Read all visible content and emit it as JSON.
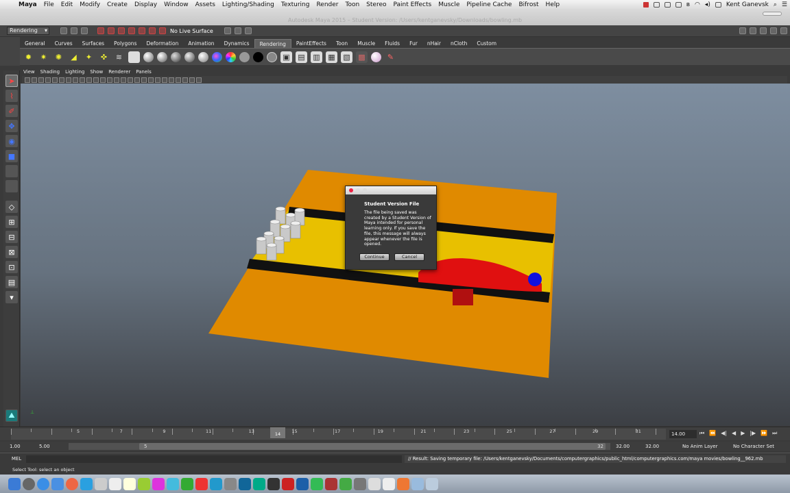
{
  "menubar": {
    "items": [
      "Maya",
      "File",
      "Edit",
      "Modify",
      "Create",
      "Display",
      "Window",
      "Assets",
      "Lighting/Shading",
      "Texturing",
      "Render",
      "Toon",
      "Stereo",
      "Paint Effects",
      "Muscle",
      "Pipeline Cache",
      "Bifrost",
      "Help"
    ],
    "user": "Kent Ganevsk"
  },
  "window": {
    "title": "Autodesk Maya 2015 – Student Version: /Users/kentganevsky/Downloads/bowling.mb"
  },
  "statusline": {
    "menuset": "Rendering",
    "live_surface": "No Live Surface"
  },
  "shelf": {
    "tabs": [
      "General",
      "Curves",
      "Surfaces",
      "Polygons",
      "Deformation",
      "Animation",
      "Dynamics",
      "Rendering",
      "PaintEffects",
      "Toon",
      "Muscle",
      "Fluids",
      "Fur",
      "nHair",
      "nCloth",
      "Custom"
    ],
    "active_tab": "Rendering"
  },
  "panel": {
    "menus": [
      "View",
      "Shading",
      "Lighting",
      "Show",
      "Renderer",
      "Panels"
    ]
  },
  "dialog": {
    "title": "Student Version File",
    "message": "The file being saved was created by a Student Version of Maya intended for personal learning only. If you save the file, this message will always appear whenever the file is opened.",
    "continue_label": "Continue",
    "cancel_label": "Cancel"
  },
  "timeslider": {
    "ticks": [
      "2",
      "4",
      "6",
      "8",
      "10",
      "12",
      "14",
      "16",
      "18",
      "20",
      "22",
      "24",
      "26",
      "28",
      "30",
      "32"
    ],
    "labels": [
      "5",
      "7",
      "9",
      "11",
      "13",
      "15",
      "17",
      "19",
      "21",
      "23",
      "25",
      "27",
      "29",
      "31"
    ],
    "current_frame": "14",
    "current_field": "14.00"
  },
  "range": {
    "start": "1.00",
    "start_inner": "5.00",
    "inner_handle": "5",
    "end_inner": "32",
    "end_a": "32.00",
    "end_b": "32.00",
    "anim_layer": "No Anim Layer",
    "char_set": "No Character Set"
  },
  "cmdline": {
    "mel": "MEL",
    "result": "// Result: Saving temporary file: /Users/kentganevsky/Documents/computergraphics/public_html/computergraphics.com/maya movies/bowling__962.mb"
  },
  "helpline": {
    "text": "Select Tool: select an object"
  },
  "colors": {
    "floor": "#e08a00",
    "lane": "#e8c000",
    "gutter": "#111111",
    "ball": "#1010e0",
    "car": "#e01010"
  }
}
